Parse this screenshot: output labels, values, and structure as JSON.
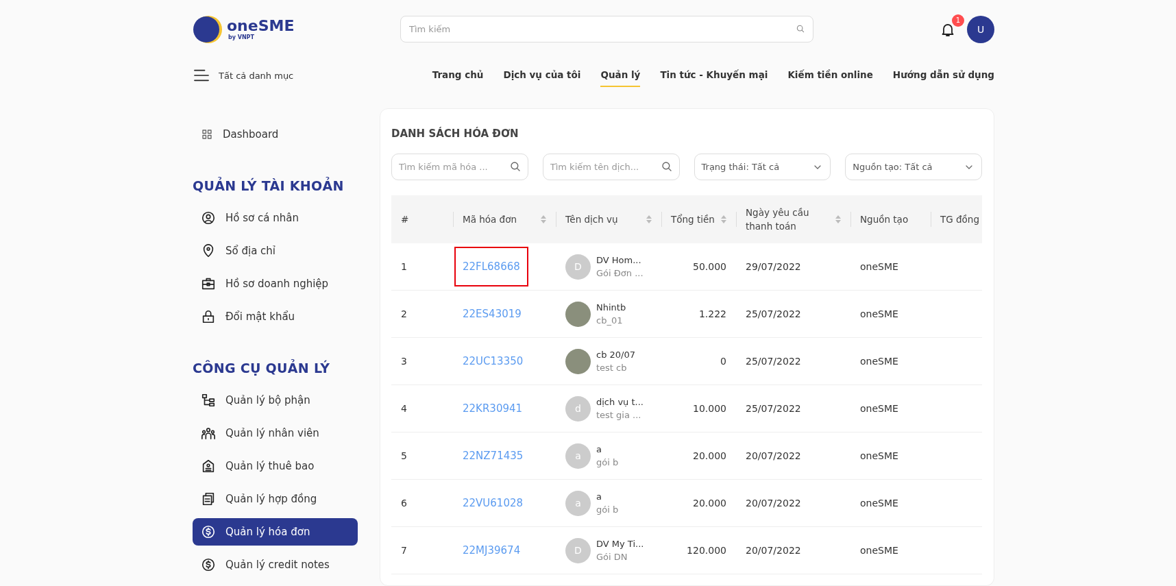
{
  "header": {
    "logo": {
      "name": "oneSME",
      "tagline": "by VNPT"
    },
    "search": {
      "placeholder": "Tìm kiếm"
    },
    "notification_count": "1",
    "user_avatar": "U"
  },
  "category_menu": "Tất cả danh mục",
  "nav": [
    {
      "label": "Trang chủ",
      "selected": false
    },
    {
      "label": "Dịch vụ của tôi",
      "selected": false
    },
    {
      "label": "Quản lý",
      "selected": true
    },
    {
      "label": "Tin tức - Khuyến mại",
      "selected": false
    },
    {
      "label": "Kiếm tiền online",
      "selected": false
    },
    {
      "label": "Hướng dẫn sử dụng",
      "selected": false
    }
  ],
  "sidebar": {
    "top_items": [
      {
        "label": "Dashboard",
        "selected": false
      }
    ],
    "sections": [
      {
        "title": "QUẢN LÝ TÀI KHOẢN",
        "items": [
          {
            "label": "Hồ sơ cá nhân",
            "selected": false
          },
          {
            "label": "Sổ địa chỉ",
            "selected": false
          },
          {
            "label": "Hồ sơ doanh nghiệp",
            "selected": false
          },
          {
            "label": "Đổi mật khẩu",
            "selected": false
          }
        ]
      },
      {
        "title": "CÔNG CỤ QUẢN LÝ",
        "items": [
          {
            "label": "Quản lý bộ phận",
            "selected": false
          },
          {
            "label": "Quản lý nhân viên",
            "selected": false
          },
          {
            "label": "Quản lý thuê bao",
            "selected": false
          },
          {
            "label": "Quản lý hợp đồng",
            "selected": false
          },
          {
            "label": "Quản lý hóa đơn",
            "selected": true
          },
          {
            "label": "Quản lý credit notes",
            "selected": false
          }
        ]
      }
    ]
  },
  "main": {
    "title": "DANH SÁCH HÓA ĐƠN",
    "filters": [
      {
        "kind": "search",
        "placeholder": "Tìm kiếm mã hóa ..."
      },
      {
        "kind": "search",
        "placeholder": "Tìm kiếm tên dịch..."
      },
      {
        "kind": "select",
        "value": "Trạng thái: Tất cả"
      },
      {
        "kind": "select",
        "value": "Nguồn tạo: Tất cả"
      }
    ],
    "table": {
      "columns": [
        {
          "label": "#",
          "sortable": false
        },
        {
          "label": "Mã hóa đơn",
          "sortable": true
        },
        {
          "label": "Tên dịch vụ",
          "sortable": true
        },
        {
          "label": "Tổng tiền",
          "sortable": true
        },
        {
          "label": "Ngày yêu cầu thanh toán",
          "sortable": true
        },
        {
          "label": "Nguồn tạo",
          "sortable": false
        },
        {
          "label": "TG đồng"
        }
      ],
      "rows": [
        {
          "index": "1",
          "invoice_code": "22FL68668",
          "highlighted": true,
          "service": {
            "kind": "letter",
            "avatar_letter": "D",
            "name": "DV Hom...",
            "package": "Gói Đơn ..."
          },
          "total": "50.000",
          "requested_date": "29/07/2022",
          "source": "oneSME"
        },
        {
          "index": "2",
          "invoice_code": "22ES43019",
          "highlighted": false,
          "service": {
            "kind": "photo",
            "name": "Nhintb",
            "package": "cb_01"
          },
          "total": "1.222",
          "requested_date": "25/07/2022",
          "source": "oneSME"
        },
        {
          "index": "3",
          "invoice_code": "22UC13350",
          "highlighted": false,
          "service": {
            "kind": "photo",
            "name": "cb 20/07",
            "package": "test cb"
          },
          "total": "0",
          "requested_date": "25/07/2022",
          "source": "oneSME"
        },
        {
          "index": "4",
          "invoice_code": "22KR30941",
          "highlighted": false,
          "service": {
            "kind": "letter",
            "avatar_letter": "d",
            "name": "dịch vụ t...",
            "package": "test gia ..."
          },
          "total": "10.000",
          "requested_date": "25/07/2022",
          "source": "oneSME"
        },
        {
          "index": "5",
          "invoice_code": "22NZ71435",
          "highlighted": false,
          "service": {
            "kind": "letter",
            "avatar_letter": "a",
            "name": "a",
            "package": "gói b"
          },
          "total": "20.000",
          "requested_date": "20/07/2022",
          "source": "oneSME"
        },
        {
          "index": "6",
          "invoice_code": "22VU61028",
          "highlighted": false,
          "service": {
            "kind": "letter",
            "avatar_letter": "a",
            "name": "a",
            "package": "gói b"
          },
          "total": "20.000",
          "requested_date": "20/07/2022",
          "source": "oneSME"
        },
        {
          "index": "7",
          "invoice_code": "22MJ39674",
          "highlighted": false,
          "service": {
            "kind": "letter",
            "avatar_letter": "D",
            "name": "DV My Ti...",
            "package": "Gói DN"
          },
          "total": "120.000",
          "requested_date": "20/07/2022",
          "source": "oneSME"
        }
      ]
    }
  }
}
